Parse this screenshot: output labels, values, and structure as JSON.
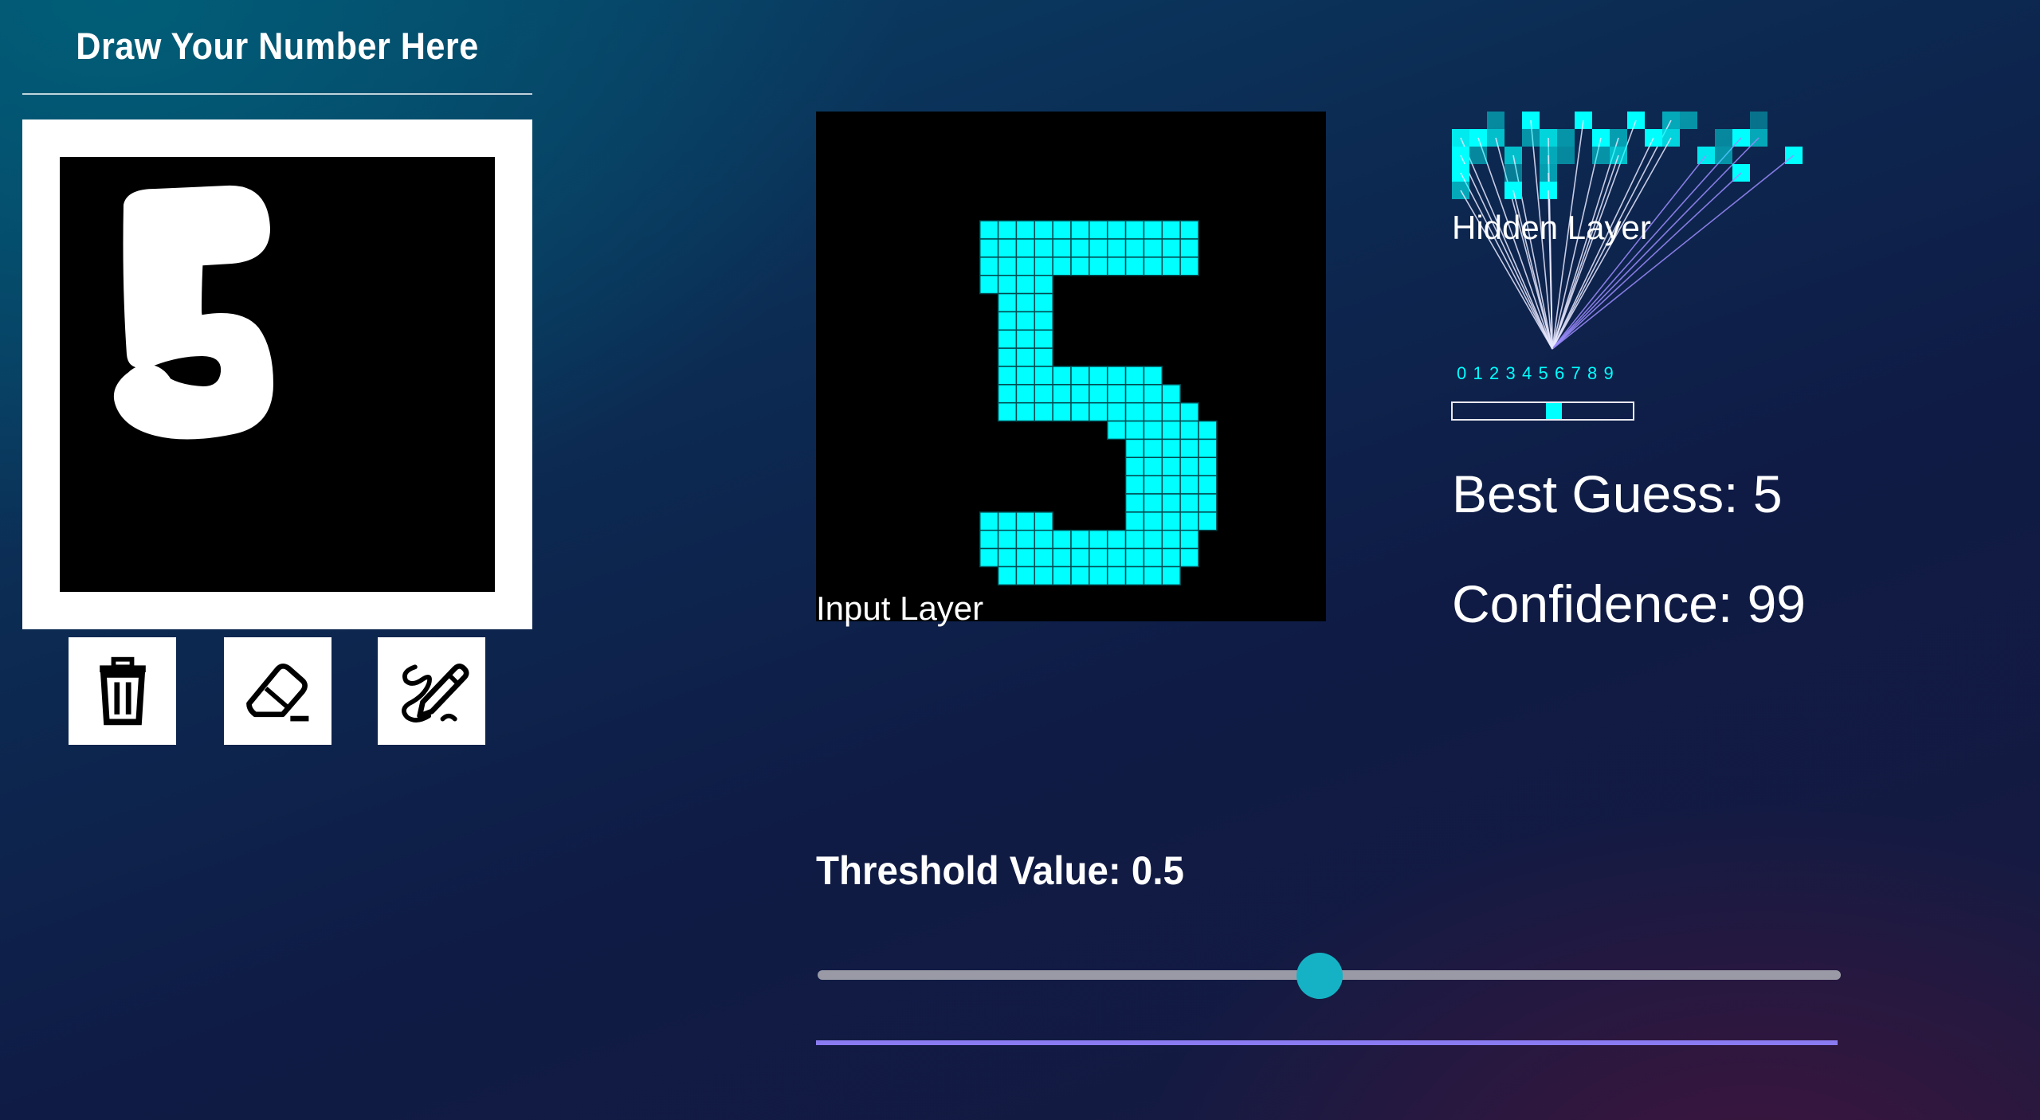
{
  "draw_panel": {
    "title": "Draw Your Number Here",
    "drawn_digit": "5",
    "tools": [
      {
        "name": "clear",
        "icon": "trash-icon"
      },
      {
        "name": "erase",
        "icon": "eraser-icon"
      },
      {
        "name": "draw",
        "icon": "pencil-squiggle-icon"
      }
    ]
  },
  "input_layer": {
    "label": "Input Layer",
    "cell_color": "#00ffff",
    "grid_rows": [
      "............................",
      "............................",
      "............................",
      "............................",
      "............................",
      "............................",
      ".........############.......",
      ".........############.......",
      ".........############.......",
      ".........####...............",
      "..........###...............",
      "..........###...............",
      "..........###...............",
      "..........###...............",
      "..........#########.........",
      "..........##########........",
      "..........###########.......",
      "................######......",
      ".................#####......",
      ".................#####......",
      ".................#####......",
      ".................#####......",
      ".........####....#####......",
      ".........############.......",
      ".........############.......",
      "..........##########........",
      "............................",
      "............................"
    ]
  },
  "hidden_layer": {
    "label": "Hidden Layer",
    "digit_labels": [
      "0",
      "1",
      "2",
      "3",
      "4",
      "5",
      "6",
      "7",
      "8",
      "9"
    ],
    "active_output": 5
  },
  "result": {
    "best_guess": "Best Guess: 5",
    "confidence": "Confidence: 99"
  },
  "threshold": {
    "label": "Threshold Value: 0.5",
    "value": 0.5,
    "min": 0,
    "max": 1
  },
  "colors": {
    "accent": "#00ffff",
    "slider_thumb": "#14b2c4",
    "underline": "#8a7bf2"
  }
}
